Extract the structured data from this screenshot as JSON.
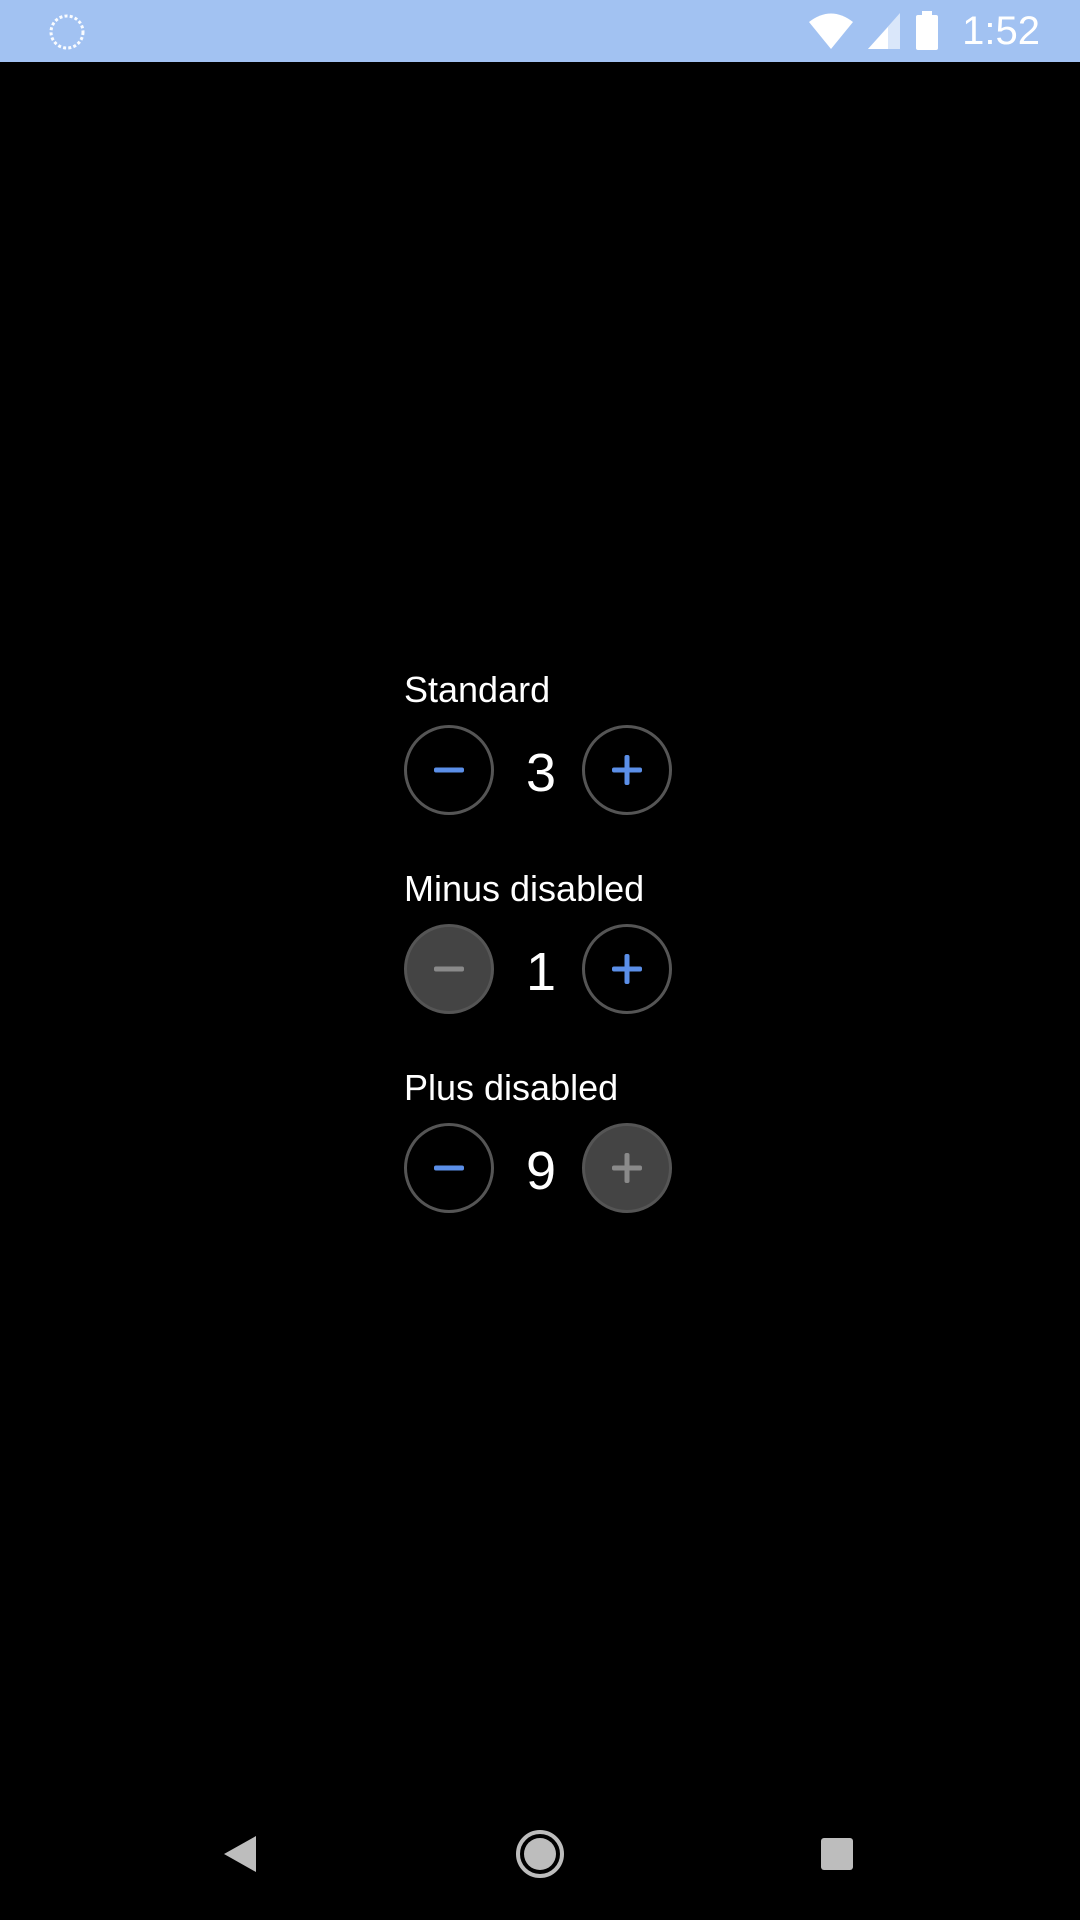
{
  "status_bar": {
    "time": "1:52",
    "left_icon": "loading-circle-icon",
    "icons": [
      "wifi-icon",
      "cellular-signal-icon",
      "battery-icon"
    ],
    "background": "#a2c2f2"
  },
  "steppers": [
    {
      "label": "Standard",
      "value": "3",
      "minus_disabled": false,
      "plus_disabled": false
    },
    {
      "label": "Minus disabled",
      "value": "1",
      "minus_disabled": true,
      "plus_disabled": false
    },
    {
      "label": "Plus disabled",
      "value": "9",
      "minus_disabled": false,
      "plus_disabled": true
    }
  ],
  "colors": {
    "accent": "#5b8fe8",
    "disabled_icon": "#8a8a8a",
    "disabled_fill": "#444444",
    "ring": "#555555"
  },
  "nav_bar": {
    "icons": [
      "back-icon",
      "home-icon",
      "recents-icon"
    ]
  }
}
